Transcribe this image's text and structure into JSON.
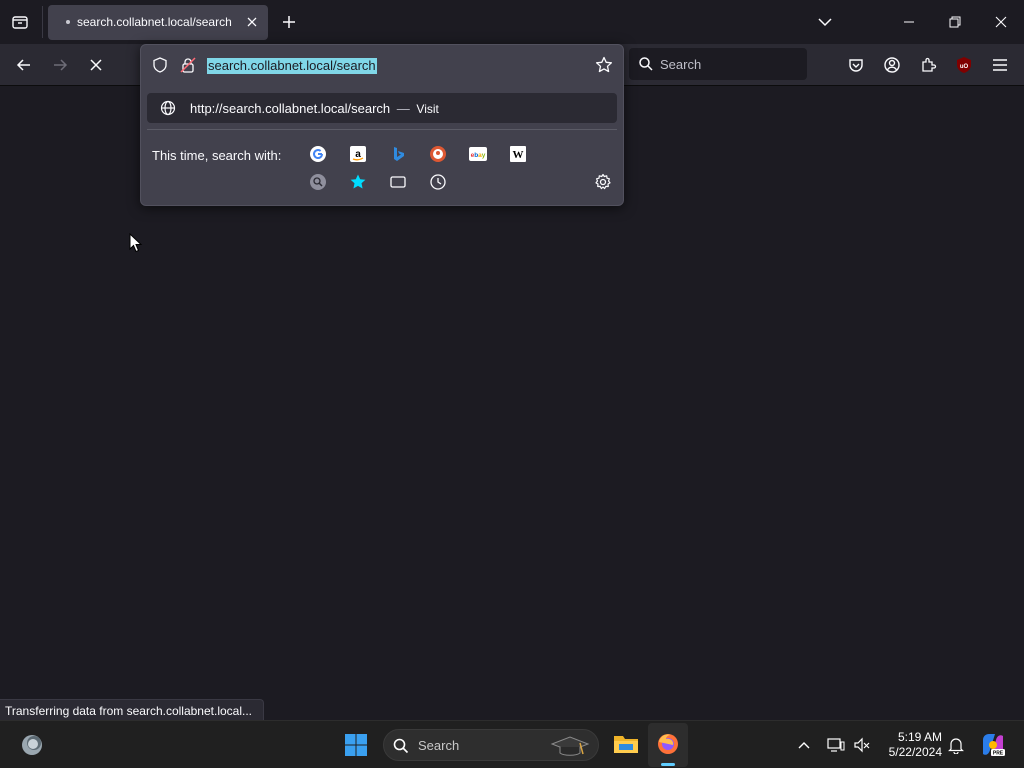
{
  "browser": {
    "tab": {
      "title": "search.collabnet.local/search"
    },
    "url_bar": {
      "value": "search.collabnet.local/search"
    },
    "search_box": {
      "placeholder": "Search"
    }
  },
  "url_dropdown": {
    "visit_url": "http://search.collabnet.local/search",
    "visit_separator": "—",
    "visit_label": "Visit",
    "search_with_label": "This time, search with:",
    "engines": [
      "Google",
      "Amazon",
      "Bing",
      "DuckDuckGo",
      "eBay",
      "Wikipedia"
    ],
    "modes": [
      "search-engines",
      "bookmarks",
      "tabs",
      "history"
    ]
  },
  "status_text": "Transferring data from search.collabnet.local...",
  "taskbar": {
    "search_placeholder": "Search",
    "time": "5:19 AM",
    "date": "5/22/2024"
  },
  "colors": {
    "chrome_bg": "#1c1b22",
    "toolbar_bg": "#2b2a33",
    "panel_bg": "#42414d",
    "selection": "#80d7e8",
    "ublock_red": "#800000"
  }
}
